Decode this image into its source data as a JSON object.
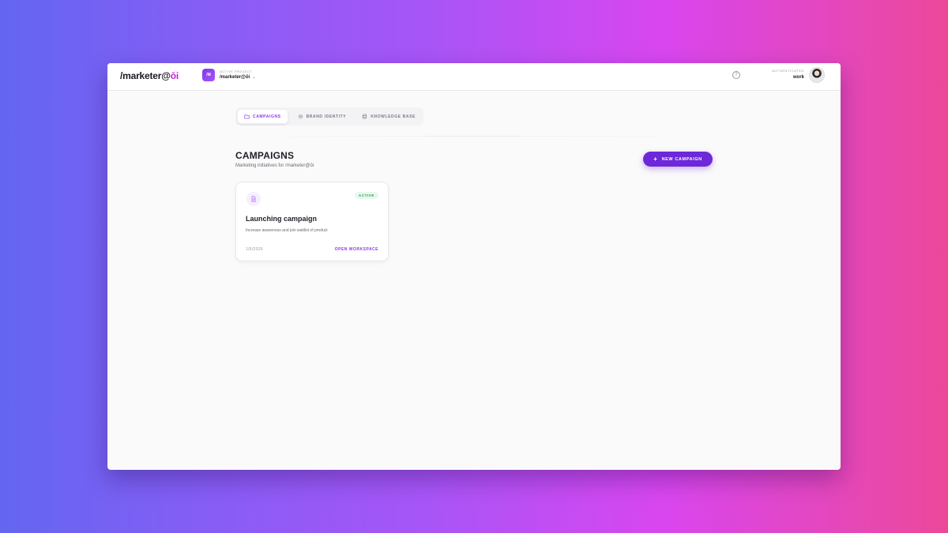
{
  "app": {
    "logo_text": "/marketer@",
    "logo_accent": "ōi"
  },
  "project": {
    "badge": "/M",
    "label": "ACTIVE PROJECT",
    "name": "/marketer@ōi",
    "chevron": "⌄"
  },
  "header": {
    "help_glyph": "?",
    "auth_label": "AUTHENTICATED",
    "auth_user": "work"
  },
  "tabs": [
    {
      "label": "CAMPAIGNS",
      "icon": "folder-icon",
      "active": true
    },
    {
      "label": "BRAND IDENTITY",
      "icon": "gear-icon",
      "active": false
    },
    {
      "label": "KNOWLEDGE BASE",
      "icon": "database-icon",
      "active": false
    }
  ],
  "page": {
    "title": "CAMPAIGNS",
    "subtitle": "Marketing initiatives for /marketer@ōi",
    "new_button_icon": "+",
    "new_button": "NEW CAMPAIGN"
  },
  "campaigns": [
    {
      "status": "ACTIVE",
      "title": "Launching campaign",
      "description": "Increase awareness and join waitlist of product",
      "date": "1/5/2026",
      "action": "OPEN WORKSPACE"
    }
  ],
  "colors": {
    "accent": "#9333ea",
    "button": "#6d28d9",
    "active_badge_bg": "#e8f8ee",
    "active_badge_text": "#22a559"
  }
}
